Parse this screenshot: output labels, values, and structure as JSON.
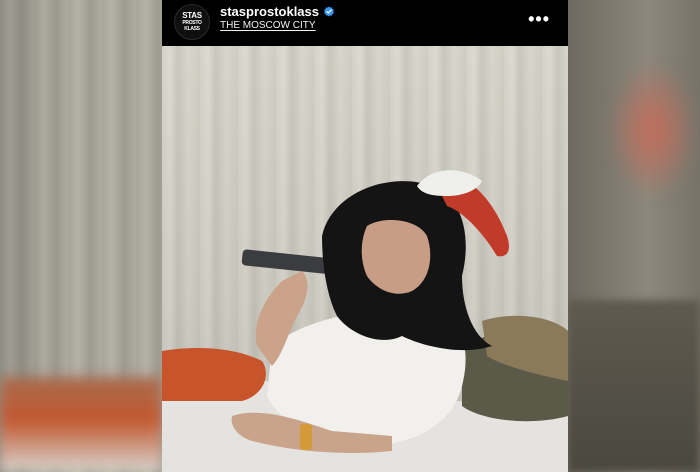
{
  "post": {
    "avatar_text": [
      "STAS",
      "PROSTO",
      "KLASS"
    ],
    "username": "stasprostoklass",
    "location": "THE MOSCOW CITY",
    "more_label": "•••"
  },
  "colors": {
    "header_bg": "#000000",
    "verified_badge": "#3897f0",
    "text": "#ffffff"
  },
  "icons": [
    "verified-badge-icon",
    "more-options-icon"
  ]
}
